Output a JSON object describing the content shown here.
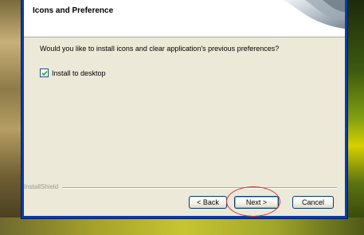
{
  "dialog": {
    "title": "Icons and Preference",
    "question": "Would you like to install icons and clear application's previous preferences?",
    "checkbox": {
      "label": "Install to desktop",
      "checked": true
    },
    "brand": "InstallShield",
    "buttons": {
      "back": "< Back",
      "next": "Next >",
      "cancel": "Cancel"
    }
  },
  "colors": {
    "frame": "#0a3ba8",
    "dialog_bg": "#ece9d8",
    "annotation": "#d23030"
  }
}
